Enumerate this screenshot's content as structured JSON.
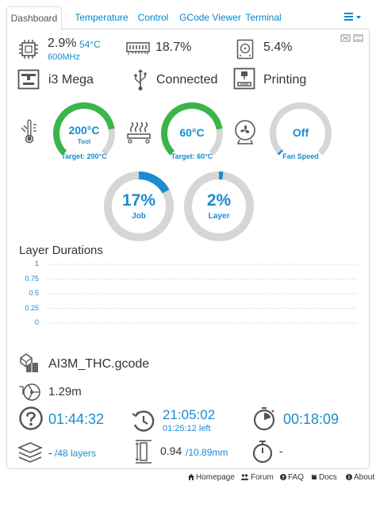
{
  "tabs": [
    {
      "label": "Dashboard",
      "active": true
    },
    {
      "label": "Temperature",
      "active": false
    },
    {
      "label": "Control",
      "active": false
    },
    {
      "label": "GCode Viewer",
      "active": false
    },
    {
      "label": "Terminal",
      "active": false
    }
  ],
  "stats": {
    "cpu_percent": "2.9%",
    "cpu_temp": "54°C",
    "cpu_freq": "600MHz",
    "memory_percent": "18.7%",
    "disk_percent": "5.4%"
  },
  "status": {
    "printer_name": "i3 Mega",
    "connection": "Connected",
    "state": "Printing"
  },
  "gauges": {
    "tool": {
      "value": "200°C",
      "label": "Tool",
      "caption": "Target: 200°C",
      "fraction": 0.8
    },
    "bed": {
      "value": "60°C",
      "label": "",
      "caption": "Target: 60°C",
      "fraction": 0.8
    },
    "fan": {
      "value": "Off",
      "label": "",
      "caption": "Fan Speed",
      "fraction": 0.0
    },
    "job": {
      "value": "17%",
      "label": "Job",
      "fraction": 0.17
    },
    "layer": {
      "value": "2%",
      "label": "Layer",
      "fraction": 0.02
    }
  },
  "colors": {
    "gauge_green": "#3ab54a",
    "gauge_blue": "#1a8ccf",
    "gauge_track": "#d6d6d6",
    "text_blue": "#1a8ccf"
  },
  "chart_data": {
    "type": "line",
    "title": "Layer Durations",
    "ylim": [
      0,
      1
    ],
    "y_ticks": [
      "1",
      "0.75",
      "0.5",
      "0.25",
      "0"
    ],
    "series": [],
    "grid": true
  },
  "job": {
    "filename": "AI3M_THC.gcode",
    "filament": "1.29m",
    "print_time": "01:44:32",
    "eta_clock": "21:05:02",
    "time_left": "01:25:12 left",
    "elapsed": "00:18:09",
    "layer_current": "-",
    "layer_total": "/48 layers",
    "height_current": "0.94",
    "height_total": "/10.89mm",
    "layer_timer": "-"
  },
  "footer": {
    "homepage": "Homepage",
    "forum": "Forum",
    "faq": "FAQ",
    "docs": "Docs",
    "about": "About"
  }
}
